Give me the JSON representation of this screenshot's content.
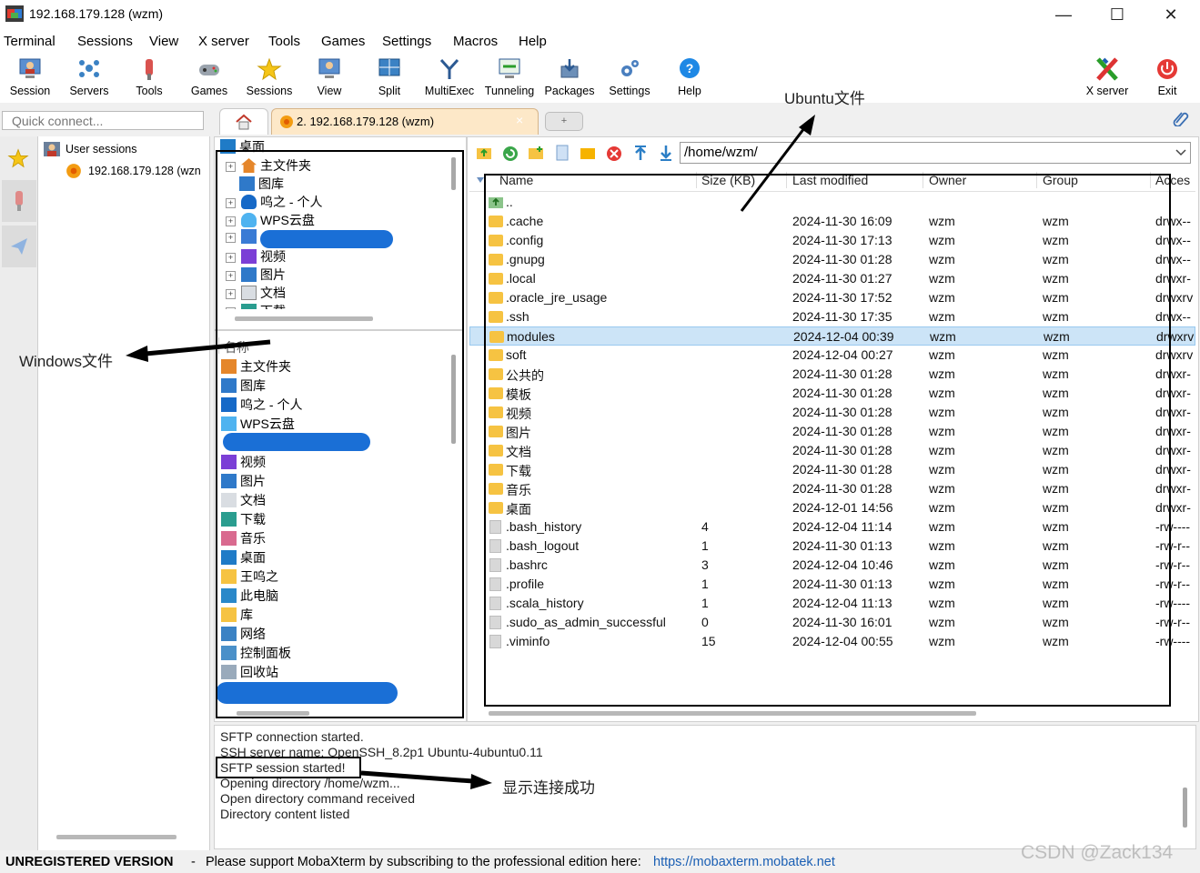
{
  "window": {
    "title": "192.168.179.128 (wzm)",
    "minimize": "—",
    "maximize": "☐",
    "close": "✕"
  },
  "menu": [
    "Terminal",
    "Sessions",
    "View",
    "X server",
    "Tools",
    "Games",
    "Settings",
    "Macros",
    "Help"
  ],
  "toolbar": {
    "session": "Session",
    "servers": "Servers",
    "tools": "Tools",
    "games": "Games",
    "sessions": "Sessions",
    "view": "View",
    "split": "Split",
    "multiexec": "MultiExec",
    "tunneling": "Tunneling",
    "packages": "Packages",
    "settings": "Settings",
    "help": "Help",
    "xserver": "X server",
    "exit": "Exit"
  },
  "quick_connect_placeholder": "Quick connect...",
  "tabs": {
    "session_tab": "2. 192.168.179.128 (wzm)",
    "close": "×",
    "new_tab": "+"
  },
  "sidebar": {
    "group": "User sessions",
    "session": "192.168.179.128 (wzn"
  },
  "windows_tree_top": [
    "桌面",
    "主文件夹",
    "图库",
    "呜之 - 个人",
    "WPS云盘",
    "视频",
    "图片",
    "文档",
    "下载"
  ],
  "windows_list_header": "名称",
  "windows_list": [
    "主文件夹",
    "图库",
    "呜之 - 个人",
    "WPS云盘",
    "视频",
    "图片",
    "文档",
    "下载",
    "音乐",
    "桌面",
    "王呜之",
    "此电脑",
    "库",
    "网络",
    "控制面板",
    "回收站"
  ],
  "sftp": {
    "path": "/home/wzm/",
    "columns": {
      "name": "Name",
      "size": "Size (KB)",
      "modified": "Last modified",
      "owner": "Owner",
      "group": "Group",
      "access": "Acces"
    },
    "parent": "..",
    "rows": [
      {
        "name": ".cache",
        "size": "",
        "modified": "2024-11-30 16:09",
        "owner": "wzm",
        "group": "wzm",
        "access": "drwx--",
        "type": "folder"
      },
      {
        "name": ".config",
        "size": "",
        "modified": "2024-11-30 17:13",
        "owner": "wzm",
        "group": "wzm",
        "access": "drwx--",
        "type": "folder"
      },
      {
        "name": ".gnupg",
        "size": "",
        "modified": "2024-11-30 01:28",
        "owner": "wzm",
        "group": "wzm",
        "access": "drwx--",
        "type": "folder"
      },
      {
        "name": ".local",
        "size": "",
        "modified": "2024-11-30 01:27",
        "owner": "wzm",
        "group": "wzm",
        "access": "drwxr-",
        "type": "folder"
      },
      {
        "name": ".oracle_jre_usage",
        "size": "",
        "modified": "2024-11-30 17:52",
        "owner": "wzm",
        "group": "wzm",
        "access": "drwxrv",
        "type": "folder"
      },
      {
        "name": ".ssh",
        "size": "",
        "modified": "2024-11-30 17:35",
        "owner": "wzm",
        "group": "wzm",
        "access": "drwx--",
        "type": "folder"
      },
      {
        "name": "modules",
        "size": "",
        "modified": "2024-12-04 00:39",
        "owner": "wzm",
        "group": "wzm",
        "access": "drwxrv",
        "type": "folder",
        "selected": true
      },
      {
        "name": "soft",
        "size": "",
        "modified": "2024-12-04 00:27",
        "owner": "wzm",
        "group": "wzm",
        "access": "drwxrv",
        "type": "folder"
      },
      {
        "name": "公共的",
        "size": "",
        "modified": "2024-11-30 01:28",
        "owner": "wzm",
        "group": "wzm",
        "access": "drwxr-",
        "type": "folder"
      },
      {
        "name": "模板",
        "size": "",
        "modified": "2024-11-30 01:28",
        "owner": "wzm",
        "group": "wzm",
        "access": "drwxr-",
        "type": "folder"
      },
      {
        "name": "视频",
        "size": "",
        "modified": "2024-11-30 01:28",
        "owner": "wzm",
        "group": "wzm",
        "access": "drwxr-",
        "type": "folder"
      },
      {
        "name": "图片",
        "size": "",
        "modified": "2024-11-30 01:28",
        "owner": "wzm",
        "group": "wzm",
        "access": "drwxr-",
        "type": "folder"
      },
      {
        "name": "文档",
        "size": "",
        "modified": "2024-11-30 01:28",
        "owner": "wzm",
        "group": "wzm",
        "access": "drwxr-",
        "type": "folder"
      },
      {
        "name": "下载",
        "size": "",
        "modified": "2024-11-30 01:28",
        "owner": "wzm",
        "group": "wzm",
        "access": "drwxr-",
        "type": "folder"
      },
      {
        "name": "音乐",
        "size": "",
        "modified": "2024-11-30 01:28",
        "owner": "wzm",
        "group": "wzm",
        "access": "drwxr-",
        "type": "folder"
      },
      {
        "name": "桌面",
        "size": "",
        "modified": "2024-12-01 14:56",
        "owner": "wzm",
        "group": "wzm",
        "access": "drwxr-",
        "type": "folder"
      },
      {
        "name": ".bash_history",
        "size": "4",
        "modified": "2024-12-04 11:14",
        "owner": "wzm",
        "group": "wzm",
        "access": "-rw----",
        "type": "file"
      },
      {
        "name": ".bash_logout",
        "size": "1",
        "modified": "2024-11-30 01:13",
        "owner": "wzm",
        "group": "wzm",
        "access": "-rw-r--",
        "type": "file"
      },
      {
        "name": ".bashrc",
        "size": "3",
        "modified": "2024-12-04 10:46",
        "owner": "wzm",
        "group": "wzm",
        "access": "-rw-r--",
        "type": "file"
      },
      {
        "name": ".profile",
        "size": "1",
        "modified": "2024-11-30 01:13",
        "owner": "wzm",
        "group": "wzm",
        "access": "-rw-r--",
        "type": "file"
      },
      {
        "name": ".scala_history",
        "size": "1",
        "modified": "2024-12-04 11:13",
        "owner": "wzm",
        "group": "wzm",
        "access": "-rw----",
        "type": "file"
      },
      {
        "name": ".sudo_as_admin_successful",
        "size": "0",
        "modified": "2024-11-30 16:01",
        "owner": "wzm",
        "group": "wzm",
        "access": "-rw-r--",
        "type": "file"
      },
      {
        "name": ".viminfo",
        "size": "15",
        "modified": "2024-12-04 00:55",
        "owner": "wzm",
        "group": "wzm",
        "access": "-rw----",
        "type": "file"
      }
    ]
  },
  "log": [
    "SFTP connection started.",
    "SSH server name: OpenSSH_8.2p1 Ubuntu-4ubuntu0.11",
    "SFTP session started!",
    "Opening directory /home/wzm...",
    "Open directory command received",
    "Directory content listed"
  ],
  "annotations": {
    "ubuntu": "Ubuntu文件",
    "windows": "Windows文件",
    "success": "显示连接成功"
  },
  "statusbar": {
    "unregistered": "UNREGISTERED VERSION",
    "sep": "-",
    "message": "Please support MobaXterm by subscribing to the professional edition here:",
    "link": "https://mobaxterm.mobatek.net"
  },
  "watermark": "CSDN @Zack134"
}
